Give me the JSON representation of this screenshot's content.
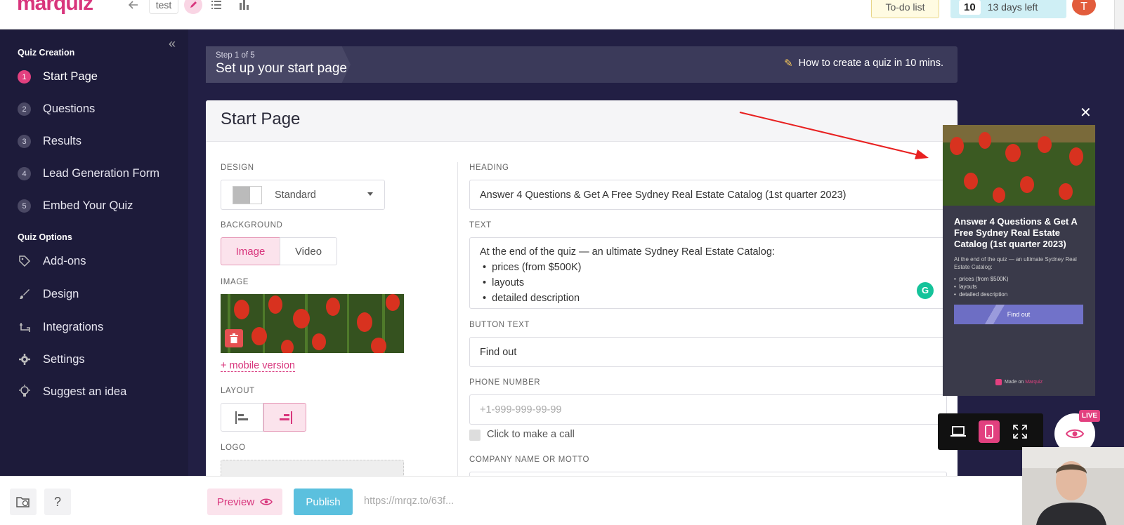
{
  "topbar": {
    "logo": "marquiz",
    "quiz_name": "test",
    "todo_label": "To-do list",
    "days_number": "10",
    "days_left": "13 days left",
    "avatar_letter": "T"
  },
  "sidebar": {
    "section_creation": "Quiz Creation",
    "creation_items": [
      {
        "num": "1",
        "label": "Start Page"
      },
      {
        "num": "2",
        "label": "Questions"
      },
      {
        "num": "3",
        "label": "Results"
      },
      {
        "num": "4",
        "label": "Lead Generation Form"
      },
      {
        "num": "5",
        "label": "Embed Your Quiz"
      }
    ],
    "section_options": "Quiz Options",
    "option_items": [
      {
        "icon": "tag-icon",
        "label": "Add-ons"
      },
      {
        "icon": "brush-icon",
        "label": "Design"
      },
      {
        "icon": "integrations-icon",
        "label": "Integrations"
      },
      {
        "icon": "gear-icon",
        "label": "Settings"
      },
      {
        "icon": "lightbulb-icon",
        "label": "Suggest an idea"
      }
    ]
  },
  "stepbar": {
    "step": "Step 1 of 5",
    "title": "Set up your start page",
    "help_link": "How to create a quiz in 10 mins."
  },
  "card": {
    "title": "Start Page",
    "design_label": "DESIGN",
    "design_value": "Standard",
    "background_label": "BACKGROUND",
    "bg_image": "Image",
    "bg_video": "Video",
    "image_label": "IMAGE",
    "mobile_version": "+ mobile version",
    "layout_label": "LAYOUT",
    "logo_label": "LOGO",
    "heading_label": "HEADING",
    "heading_value": "Answer 4 Questions & Get A Free Sydney Real Estate Catalog (1st quarter 2023)",
    "text_label": "TEXT",
    "text_intro": "At the end of the quiz — an ultimate Sydney Real Estate Catalog:",
    "text_bullets": [
      "prices (from $500K)",
      "layouts",
      "detailed description"
    ],
    "button_text_label": "BUTTON TEXT",
    "button_text_value": "Find out",
    "phone_label": "PHONE NUMBER",
    "phone_placeholder": "+1-999-999-99-99",
    "call_label": "Click to make a call",
    "company_label": "COMPANY NAME OR MOTTO"
  },
  "preview": {
    "heading": "Answer 4 Questions & Get A Free Sydney Real Estate Catalog (1st quarter 2023)",
    "text_intro": "At the end of the quiz — an ultimate Sydney Real Estate Catalog:",
    "bullets": [
      "prices (from $500K)",
      "layouts",
      "detailed description"
    ],
    "button": "Find out",
    "made_on": "Made on",
    "brand": "Marquiz",
    "live_badge": "LIVE"
  },
  "bottombar": {
    "preview_label": "Preview",
    "publish_label": "Publish",
    "url": "https://mrqz.to/63f..."
  },
  "colors": {
    "accent": "#d8357c",
    "sidebar_bg": "#1d1b3a",
    "publish": "#5bc0de"
  }
}
